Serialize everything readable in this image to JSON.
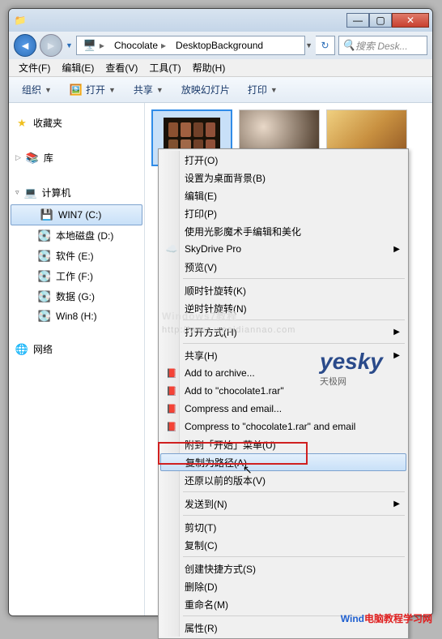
{
  "titlebar": {},
  "breadcrumb": {
    "seg1": "Chocolate",
    "seg2": "DesktopBackground"
  },
  "search": {
    "placeholder": "搜索 Desk..."
  },
  "menubar": {
    "file": "文件(F)",
    "edit": "编辑(E)",
    "view": "查看(V)",
    "tools": "工具(T)",
    "help": "帮助(H)"
  },
  "toolbar": {
    "organize": "组织",
    "open": "打开",
    "share": "共享",
    "slideshow": "放映幻灯片",
    "print": "打印"
  },
  "sidebar": {
    "favorites": "收藏夹",
    "libraries": "库",
    "computer": "计算机",
    "drives": [
      {
        "label": "WIN7 (C:)"
      },
      {
        "label": "本地磁盘 (D:)"
      },
      {
        "label": "软件 (E:)"
      },
      {
        "label": "工作 (F:)"
      },
      {
        "label": "数据 (G:)"
      },
      {
        "label": "Win8 (H:)"
      }
    ],
    "network": "网络"
  },
  "ctx": {
    "open": "打开(O)",
    "setbg": "设置为桌面背景(B)",
    "edit": "编辑(E)",
    "print": "打印(P)",
    "meitu": "使用光影魔术手编辑和美化",
    "skydrive": "SkyDrive Pro",
    "preview": "预览(V)",
    "rotcw": "顺时针旋转(K)",
    "rotccw": "逆时针旋转(N)",
    "openwith": "打开方式(H)",
    "share": "共享(H)",
    "addarc": "Add to archive...",
    "addrar": "Add to \"chocolate1.rar\"",
    "compemail": "Compress and email...",
    "comprare": "Compress to \"chocolate1.rar\" and email",
    "pinstart": "附到「开始」菜单(U)",
    "copypath": "复制为路径(A)",
    "restore": "还原以前的版本(V)",
    "sendto": "发送到(N)",
    "cut": "剪切(T)",
    "copy": "复制(C)",
    "shortcut": "创建快捷方式(S)",
    "delete": "删除(D)",
    "rename": "重命名(M)",
    "props": "属性(R)"
  },
  "watermarks": {
    "wm1": "Windows7教程",
    "wm1_sub": "http://www.woaidiannao.com",
    "wm2": "yesky",
    "wm2_sub": "天极网",
    "footer_b": "Wind",
    "footer_r": "电脑教程学习网"
  }
}
